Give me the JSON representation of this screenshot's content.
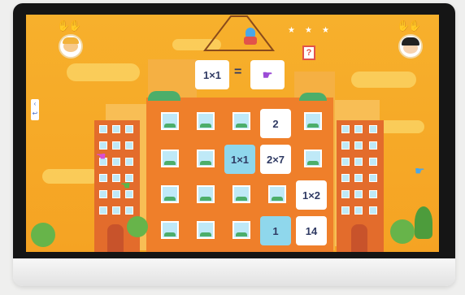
{
  "game": {
    "equation": {
      "left": "1×1",
      "operator": "=",
      "help": "?"
    },
    "tiles": [
      {
        "text": "2",
        "style": "white"
      },
      {
        "text": "1×1",
        "style": "blue"
      },
      {
        "text": "2×7",
        "style": "white"
      },
      {
        "text": "1×2",
        "style": "white"
      },
      {
        "text": "1",
        "style": "blue"
      },
      {
        "text": "14",
        "style": "white"
      }
    ],
    "stars_filled": 3,
    "players": [
      "left-player",
      "right-player"
    ]
  },
  "colors": {
    "background": "#f7a928",
    "building": "#ef7f2a",
    "tile_blue": "#8fd7ec",
    "text": "#2f3a63"
  }
}
